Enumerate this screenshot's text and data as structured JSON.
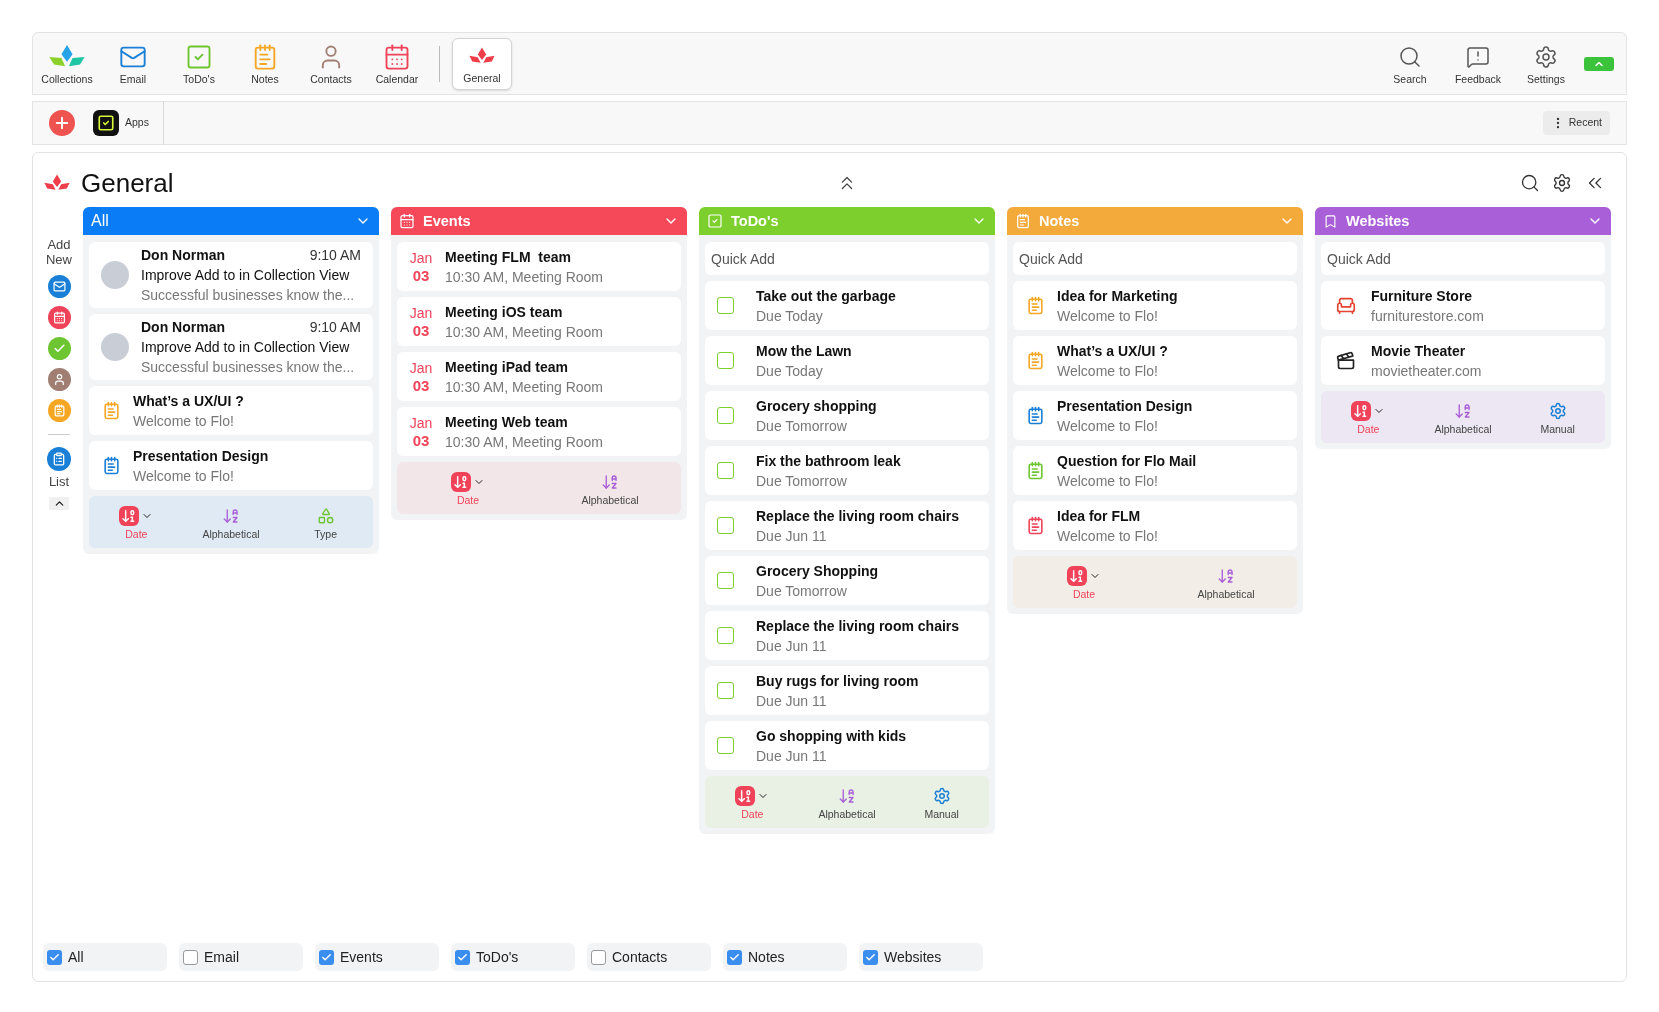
{
  "toolbar": {
    "left": [
      {
        "kind": "collections",
        "label": "Collections",
        "selected": false
      },
      {
        "kind": "email",
        "label": "Email",
        "selected": false
      },
      {
        "kind": "todo",
        "label": "ToDo's",
        "selected": false
      },
      {
        "kind": "notes",
        "label": "Notes",
        "selected": false
      },
      {
        "kind": "contacts",
        "label": "Contacts",
        "selected": false
      },
      {
        "kind": "calendar",
        "label": "Calendar",
        "selected": false
      },
      {
        "kind": "general",
        "label": "General",
        "selected": true
      }
    ],
    "toggle": {
      "on": true
    },
    "right": [
      {
        "kind": "search",
        "label": "Search"
      },
      {
        "kind": "feedback",
        "label": "Feedback"
      },
      {
        "kind": "settings",
        "label": "Settings"
      }
    ]
  },
  "secondary_bar": {
    "apps_label": "Apps",
    "recent_label": "Recent"
  },
  "page_title": "General",
  "add_new": {
    "label": "Add New",
    "items": [
      {
        "kind": "email"
      },
      {
        "kind": "calendar"
      },
      {
        "kind": "todo"
      },
      {
        "kind": "contacts"
      },
      {
        "kind": "notes"
      }
    ],
    "list_label": "List"
  },
  "columns": [
    {
      "kind": "all",
      "title": "All",
      "color": "#0a7cf5",
      "items": [
        {
          "kind": "message",
          "name": "Don Norman",
          "time": "9:10 AM",
          "subject": "Improve Add to in Collection View",
          "preview": "Successful businesses know the..."
        },
        {
          "kind": "message",
          "name": "Don Norman",
          "time": "9:10 AM",
          "subject": "Improve Add to in Collection View",
          "preview": "Successful businesses know the..."
        },
        {
          "kind": "note",
          "title": "What’s a UX/UI ?",
          "subtitle": "Welcome to Flo!",
          "color": "#f5a623"
        },
        {
          "kind": "note",
          "title": "Presentation Design",
          "subtitle": "Welcome to Flo!",
          "color": "#1a7fd6"
        }
      ],
      "sort_options": [
        {
          "kind": "date",
          "label": "Date",
          "selected": true
        },
        {
          "kind": "alpha",
          "label": "Alphabetical",
          "selected": false
        },
        {
          "kind": "type",
          "label": "Type",
          "selected": false
        }
      ]
    },
    {
      "kind": "events",
      "title": "Events",
      "color": "#f5495a",
      "items": [
        {
          "kind": "event",
          "month": "Jan",
          "day": "03",
          "title": "Meeting FLM  team",
          "subtitle": "10:30 AM, Meeting Room"
        },
        {
          "kind": "event",
          "month": "Jan",
          "day": "03",
          "title": "Meeting iOS team",
          "subtitle": "10:30 AM, Meeting Room"
        },
        {
          "kind": "event",
          "month": "Jan",
          "day": "03",
          "title": "Meeting iPad team",
          "subtitle": "10:30 AM, Meeting Room"
        },
        {
          "kind": "event",
          "month": "Jan",
          "day": "03",
          "title": "Meeting Web team",
          "subtitle": "10:30 AM, Meeting Room"
        }
      ],
      "sort_options": [
        {
          "kind": "date",
          "label": "Date",
          "selected": true
        },
        {
          "kind": "alpha",
          "label": "Alphabetical",
          "selected": false
        }
      ]
    },
    {
      "kind": "todos",
      "title": "ToDo's",
      "color": "#7ccf2c",
      "quick_add": {
        "placeholder": "Quick Add"
      },
      "items": [
        {
          "kind": "todo",
          "title": "Take out the garbage",
          "subtitle": "Due Today",
          "checked": false
        },
        {
          "kind": "todo",
          "title": "Mow the Lawn",
          "subtitle": "Due Today",
          "checked": false
        },
        {
          "kind": "todo",
          "title": "Grocery shopping",
          "subtitle": "Due Tomorrow",
          "checked": false
        },
        {
          "kind": "todo",
          "title": "Fix the bathroom leak",
          "subtitle": "Due Tomorrow",
          "checked": false
        },
        {
          "kind": "todo",
          "title": "Replace the living room chairs",
          "subtitle": "Due Jun 11",
          "checked": false
        },
        {
          "kind": "todo",
          "title": "Grocery Shopping",
          "subtitle": "Due Tomorrow",
          "checked": false
        },
        {
          "kind": "todo",
          "title": "Replace the living room chairs",
          "subtitle": "Due Jun 11",
          "checked": false
        },
        {
          "kind": "todo",
          "title": "Buy rugs for living room",
          "subtitle": "Due Jun 11",
          "checked": false
        },
        {
          "kind": "todo",
          "title": "Go shopping with kids",
          "subtitle": "Due Jun 11",
          "checked": false
        }
      ],
      "sort_options": [
        {
          "kind": "date",
          "label": "Date",
          "selected": true
        },
        {
          "kind": "alpha",
          "label": "Alphabetical",
          "selected": false
        },
        {
          "kind": "manual",
          "label": "Manual",
          "selected": false
        }
      ]
    },
    {
      "kind": "notes",
      "title": "Notes",
      "color": "#f4a93b",
      "quick_add": {
        "placeholder": "Quick Add"
      },
      "items": [
        {
          "kind": "note",
          "title": "Idea for Marketing",
          "subtitle": "Welcome to Flo!",
          "color": "#f5a623"
        },
        {
          "kind": "note",
          "title": "What’s a UX/UI ?",
          "subtitle": "Welcome to Flo!",
          "color": "#f5a623"
        },
        {
          "kind": "note",
          "title": "Presentation Design",
          "subtitle": "Welcome to Flo!",
          "color": "#1a7fd6"
        },
        {
          "kind": "note",
          "title": "Question for Flo Mail",
          "subtitle": "Welcome to Flo!",
          "color": "#6cc531"
        },
        {
          "kind": "note",
          "title": "Idea for FLM",
          "subtitle": "Welcome to Flo!",
          "color": "#f0435a"
        }
      ],
      "sort_options": [
        {
          "kind": "date",
          "label": "Date",
          "selected": true
        },
        {
          "kind": "alpha",
          "label": "Alphabetical",
          "selected": false
        }
      ]
    },
    {
      "kind": "websites",
      "title": "Websites",
      "color": "#a95fd8",
      "quick_add": {
        "placeholder": "Quick Add"
      },
      "items": [
        {
          "kind": "website",
          "title": "Furniture Store",
          "subtitle": "furniturestore.com"
        },
        {
          "kind": "website",
          "title": "Movie Theater",
          "subtitle": "movietheater.com"
        }
      ],
      "sort_options": [
        {
          "kind": "date",
          "label": "Date",
          "selected": true
        },
        {
          "kind": "alpha",
          "label": "Alphabetical",
          "selected": false
        },
        {
          "kind": "manual",
          "label": "Manual",
          "selected": false
        }
      ]
    }
  ],
  "filters": [
    {
      "label": "All",
      "checked": true
    },
    {
      "label": "Email",
      "checked": false
    },
    {
      "label": "Events",
      "checked": true
    },
    {
      "label": "ToDo's",
      "checked": true
    },
    {
      "label": "Contacts",
      "checked": false
    },
    {
      "label": "Notes",
      "checked": true
    },
    {
      "label": "Websites",
      "checked": true
    }
  ]
}
